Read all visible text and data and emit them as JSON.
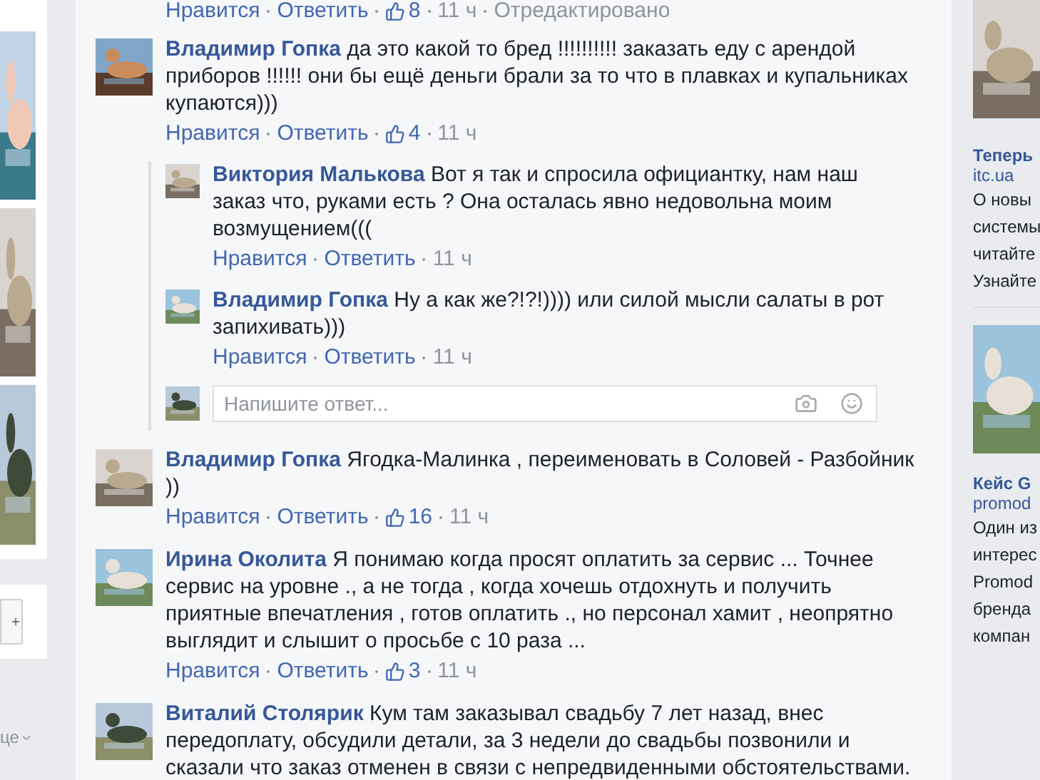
{
  "top_actions": {
    "like": "Нравится",
    "reply": "Ответить",
    "likes": "8",
    "time": "11 ч",
    "edited": "Отредактировано"
  },
  "comments": [
    {
      "author": "Владимир Гопка",
      "text": "да это какой то бред !!!!!!!!!! заказать еду с арендой приборов !!!!!! они бы ещё деньги брали за то что в плавках и купальниках купаются)))",
      "like": "Нравится",
      "reply": "Ответить",
      "likes": "4",
      "time": "11 ч",
      "replies": [
        {
          "author": "Виктория Малькова",
          "text": "Вот я так и спросила официантку, нам наш заказ что, руками есть ? Она осталась явно недовольна моим возмущением(((",
          "like": "Нравится",
          "reply": "Ответить",
          "time": "11 ч"
        },
        {
          "author": "Владимир Гопка",
          "text": "Ну а как же?!?!)))) или силой мысли салаты в рот запихивать)))",
          "like": "Нравится",
          "reply": "Ответить",
          "time": "11 ч"
        }
      ],
      "reply_box": {
        "placeholder": "Напишите ответ..."
      }
    },
    {
      "author": "Владимир Гопка",
      "text": "Ягодка-Малинка , переименовать в Соловей - Разбойник ))",
      "like": "Нравится",
      "reply": "Ответить",
      "likes": "16",
      "time": "11 ч"
    },
    {
      "author": "Ирина Околита",
      "text": "Я понимаю когда просят оплатить за сервис ... Точнее сервис на уровне ., а не тогда , когда хочешь отдохнуть и получить приятные впечатления , готов оплатить ., но персонал хамит , неопрятно выглядит и слышит о просьбе с 10 раза ...",
      "like": "Нравится",
      "reply": "Ответить",
      "likes": "3",
      "time": "11 ч"
    },
    {
      "author": "Виталий Столярик",
      "text": "Кум там заказывал свадьбу 7 лет назад, внес передоплату, обсудили детали, за 3 недели до свадьбы позвонили и сказали что заказ отменен в связи с непредвиденными обстоятельствами."
    }
  ],
  "left_sidebar": {
    "language": "це"
  },
  "ads": [
    {
      "title": "Теперь",
      "site": "itc.ua",
      "lines": [
        "О новы",
        "системы",
        "читайте",
        "Узнайте"
      ]
    },
    {
      "title": "Кейс G",
      "site": "promod",
      "lines": [
        "Один из",
        "интерес",
        "Promod",
        "бренда",
        "компан"
      ]
    }
  ]
}
